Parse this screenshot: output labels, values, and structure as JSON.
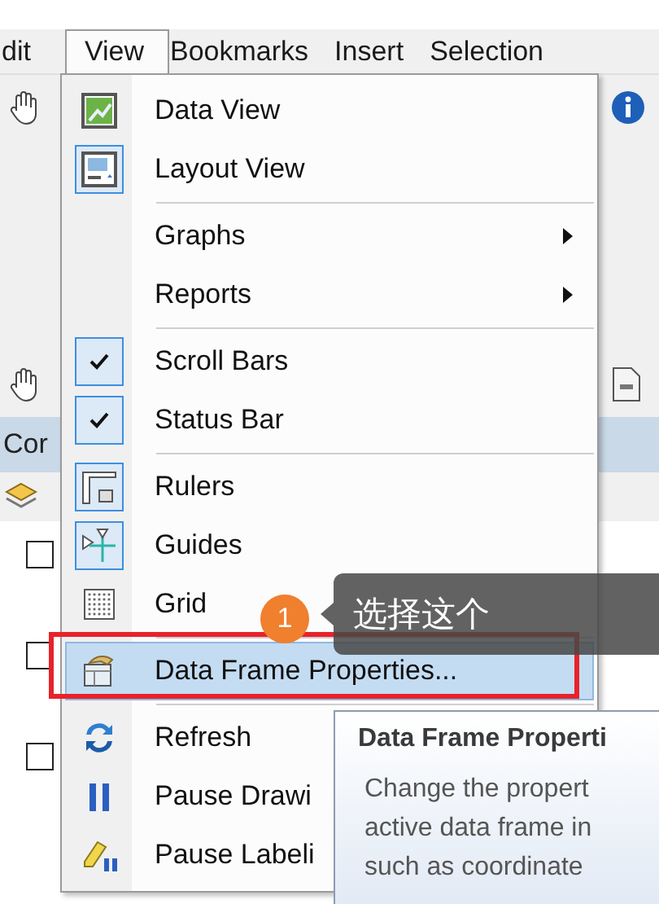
{
  "menubar": [
    {
      "label": "dit",
      "selected": false
    },
    {
      "label": "View",
      "selected": true
    },
    {
      "label": "Bookmarks",
      "selected": false
    },
    {
      "label": "Insert",
      "selected": false
    },
    {
      "label": "Selection",
      "selected": false
    }
  ],
  "panel": {
    "title": "Cor"
  },
  "layers": [
    {
      "checked": false
    },
    {
      "checked": false
    },
    {
      "checked": false
    }
  ],
  "menu": {
    "items": [
      {
        "kind": "item",
        "label": "Data View",
        "checked": false,
        "submenu": false,
        "selected": false
      },
      {
        "kind": "item",
        "label": "Layout View",
        "checked": true,
        "submenu": false,
        "selected": false
      },
      {
        "kind": "separator"
      },
      {
        "kind": "item",
        "label": "Graphs",
        "checked": false,
        "submenu": true,
        "selected": false
      },
      {
        "kind": "item",
        "label": "Reports",
        "checked": false,
        "submenu": true,
        "selected": false
      },
      {
        "kind": "separator"
      },
      {
        "kind": "item",
        "label": "Scroll Bars",
        "checked": true,
        "submenu": false,
        "selected": false
      },
      {
        "kind": "item",
        "label": "Status Bar",
        "checked": true,
        "submenu": false,
        "selected": false
      },
      {
        "kind": "separator"
      },
      {
        "kind": "item",
        "label": "Rulers",
        "checked": true,
        "submenu": false,
        "selected": false
      },
      {
        "kind": "item",
        "label": "Guides",
        "checked": true,
        "submenu": false,
        "selected": false
      },
      {
        "kind": "item",
        "label": "Grid",
        "checked": false,
        "submenu": false,
        "selected": false
      },
      {
        "kind": "separator"
      },
      {
        "kind": "item",
        "label": "Data Frame Properties...",
        "checked": false,
        "submenu": false,
        "selected": true
      },
      {
        "kind": "separator"
      },
      {
        "kind": "item",
        "label": "Refresh",
        "checked": false,
        "submenu": false,
        "selected": false
      },
      {
        "kind": "item",
        "label": "Pause Drawi",
        "checked": false,
        "submenu": false,
        "selected": false
      },
      {
        "kind": "item",
        "label": "Pause Labeli",
        "checked": false,
        "submenu": false,
        "selected": false
      }
    ]
  },
  "annotation": {
    "badge": "1",
    "callout": "选择这个"
  },
  "tooltip": {
    "title": "Data Frame Properti",
    "lines": [
      "Change the propert",
      "active data frame in",
      "such as coordinate"
    ]
  }
}
